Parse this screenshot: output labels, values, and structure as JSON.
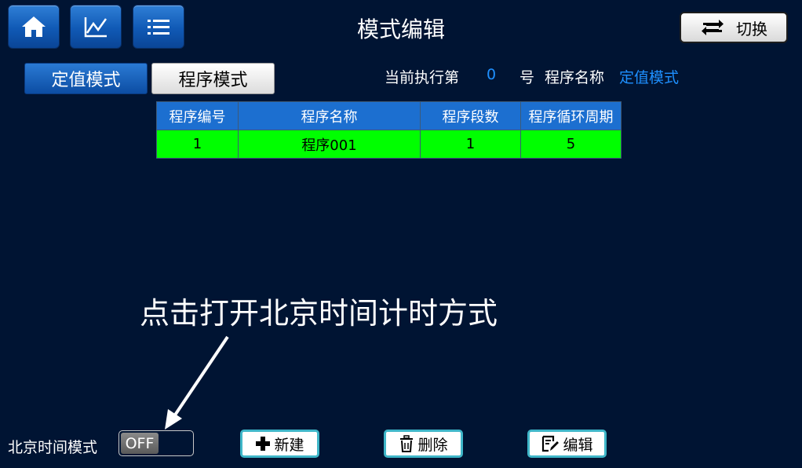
{
  "header": {
    "title": "模式编辑",
    "switch_label": "切换",
    "nav_icons": [
      "home-icon",
      "chart-icon",
      "list-icon"
    ]
  },
  "tabs": [
    {
      "label": "定值模式",
      "active": false
    },
    {
      "label": "程序模式",
      "active": true
    }
  ],
  "status": {
    "exec_prefix": "当前执行第",
    "exec_number": "0",
    "exec_suffix": "号",
    "program_name_label": "程序名称",
    "program_name_value": "定值模式"
  },
  "table": {
    "headers": [
      "程序编号",
      "程序名称",
      "程序段数",
      "程序循环周期"
    ],
    "rows": [
      [
        "1",
        "程序001",
        "1",
        "5"
      ]
    ]
  },
  "annotation": {
    "text": "点击打开北京时间计时方式"
  },
  "footer": {
    "beijing_label": "北京时间模式",
    "toggle_state": "OFF",
    "new_label": "新建",
    "delete_label": "删除",
    "edit_label": "编辑"
  },
  "colors": {
    "background": "#001433",
    "accent_blue": "#1e90ff",
    "row_green": "#00ff00",
    "button_border": "#3fb6c8"
  }
}
